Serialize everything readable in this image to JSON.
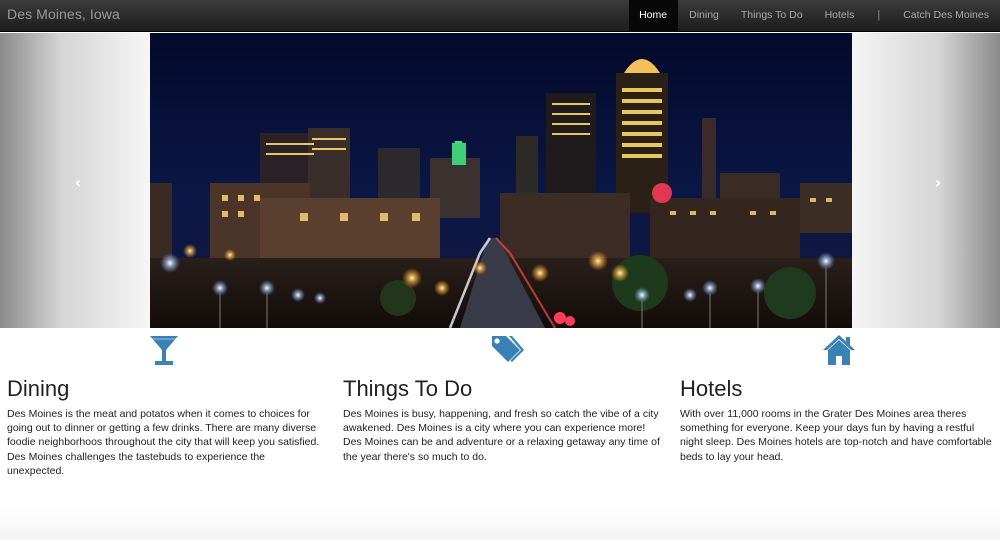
{
  "navbar": {
    "brand": "Des Moines, Iowa",
    "items": [
      {
        "label": "Home",
        "active": true
      },
      {
        "label": "Dining"
      },
      {
        "label": "Things To Do"
      },
      {
        "label": "Hotels"
      },
      {
        "label": "Catch Des Moines"
      }
    ],
    "separator": "|"
  },
  "carousel": {
    "prev_icon": "chevron-left-icon",
    "next_icon": "chevron-right-icon",
    "prev_glyph": "‹",
    "next_glyph": "›"
  },
  "features": [
    {
      "icon": "cocktail-glass-icon",
      "title": "Dining",
      "text": "Des Moines is the meat and potatos when it comes to choices for going out to dinner or getting a few drinks. There are many diverse foodie neighborhoos throughout the city that will keep you satisfied. Des Moines challenges the tastebuds to experience the unexpected."
    },
    {
      "icon": "tags-icon",
      "title": "Things To Do",
      "text": "Des Moines is busy, happening, and fresh so catch the vibe of a city awakened. Des Moines is a city where you can experience more! Des Moines can be and adventure or a relaxing getaway any time of the year there's so much to do."
    },
    {
      "icon": "home-icon",
      "title": "Hotels",
      "text": "With over 11,000 rooms in the Grater Des Moines area theres something for everyone. Keep your days fun by having a restful night sleep. Des Moines hotels are top-notch and have comfortable beds to lay your head."
    }
  ],
  "colors": {
    "accent": "#3a82b5",
    "navbar": "#222222",
    "nav_active": "#080808"
  }
}
